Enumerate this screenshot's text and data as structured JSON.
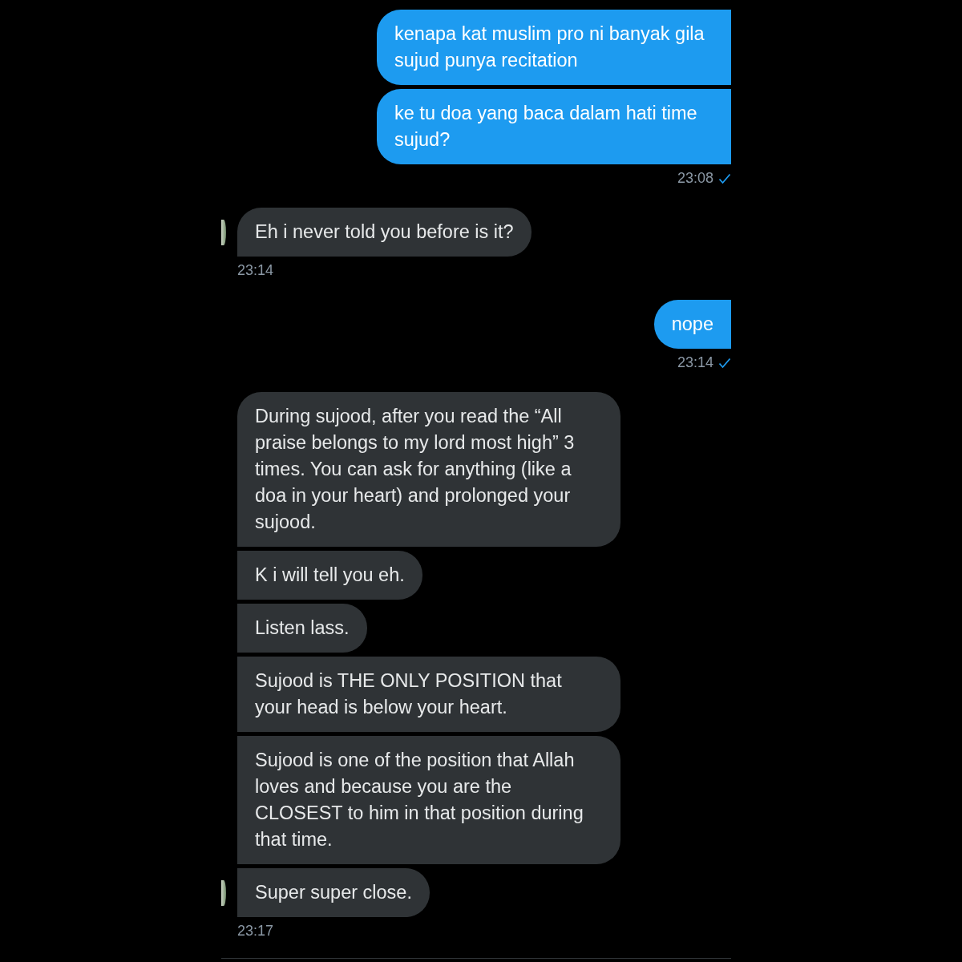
{
  "messages": [
    {
      "kind": "sent",
      "bubbles": [
        "kenapa kat muslim pro ni banyak gila sujud punya recitation",
        "ke tu doa yang baca dalam hati time sujud?"
      ],
      "time": "23:08",
      "read": true
    },
    {
      "kind": "received",
      "bubbles": [
        "Eh i never told you before is it?"
      ],
      "time": "23:14"
    },
    {
      "kind": "sent",
      "bubbles": [
        "nope"
      ],
      "time": "23:14",
      "read": true
    },
    {
      "kind": "received",
      "bubbles": [
        "During sujood, after you read the “All praise belongs to my lord most high” 3 times. You can ask for anything (like a doa in your heart) and prolonged your sujood.",
        "K i will tell you eh.",
        "Listen lass.",
        "Sujood is THE ONLY POSITION that your head is below your heart.",
        "Sujood is one of the position that Allah loves and because you are the CLOSEST to him in that position during that time.",
        "Super super close."
      ],
      "time": "23:17"
    }
  ]
}
